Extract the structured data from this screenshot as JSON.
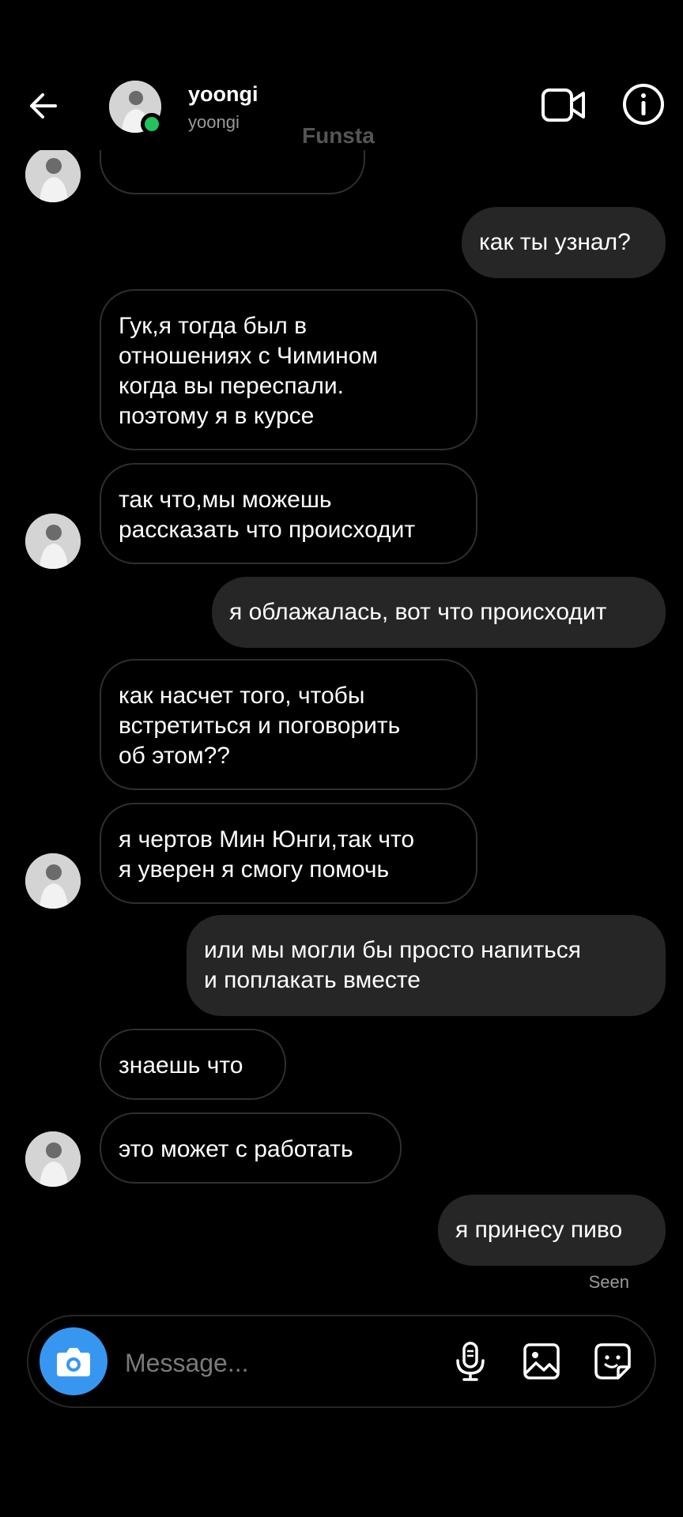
{
  "header": {
    "name": "yoongi",
    "username": "yoongi",
    "label": "Funsta"
  },
  "messages": [
    {
      "side": "in",
      "text": ""
    },
    {
      "side": "out",
      "text": "как ты узнал?"
    },
    {
      "side": "in",
      "text": "Гук,я тогда был в\nотношениях с Чимином\nкогда вы переспали.\nпоэтому я в курсе"
    },
    {
      "side": "in",
      "text": "так что,мы можешь\nрассказать что происходит"
    },
    {
      "side": "out",
      "text": "я облажалась, вот что происходит"
    },
    {
      "side": "in",
      "text": " как насчет того, чтобы\nвстретиться и поговорить\nоб этом??"
    },
    {
      "side": "in",
      "text": "я чертов Мин Юнги,так что\nя уверен я смогу помочь"
    },
    {
      "side": "out",
      "text": "или мы могли бы просто напиться\nи поплакать вместе"
    },
    {
      "side": "in",
      "text": " знаешь что"
    },
    {
      "side": "in",
      "text": "это может с работать"
    },
    {
      "side": "out",
      "text": "я принесу пиво"
    }
  ],
  "status": {
    "seen": "Seen"
  },
  "composer": {
    "placeholder": "Message..."
  },
  "icons": {
    "back": "arrow-left",
    "video": "video-camera",
    "info": "info-circle",
    "camera": "camera",
    "mic": "microphone",
    "gallery": "image",
    "sticker": "sticker"
  },
  "colors": {
    "background": "#000000",
    "outgoing_bubble": "#262626",
    "accent": "#3797f0",
    "online": "#22c25e"
  }
}
